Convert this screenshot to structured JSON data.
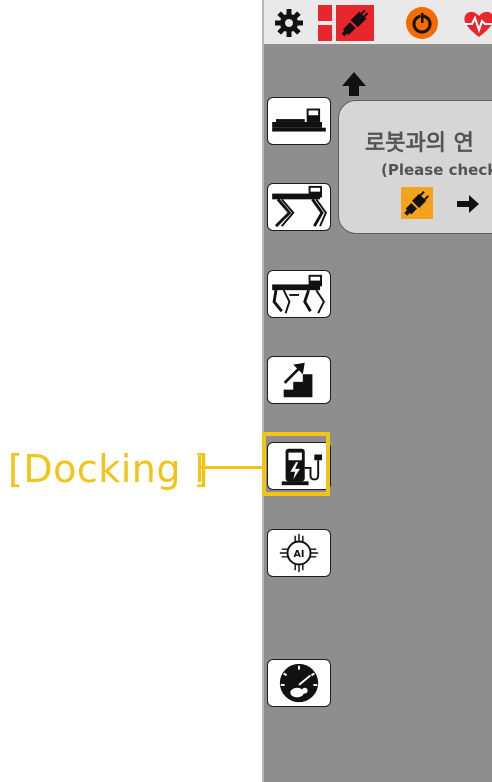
{
  "annotation": {
    "label": "[Docking ]",
    "color": "#f2c417"
  },
  "topbar": {
    "icons": [
      "gear-icon",
      "network-disconnected-icon",
      "power-icon",
      "heart-rate-icon"
    ],
    "status_color": "#e8262b"
  },
  "message": {
    "title": "로봇과의 연",
    "subtitle": "(Please check"
  },
  "sidebar": {
    "items": [
      {
        "name": "lie-down-mode-button",
        "icon": "robot-lying-icon"
      },
      {
        "name": "stand-mode-button",
        "icon": "robot-standing-icon"
      },
      {
        "name": "walk-mode-button",
        "icon": "robot-walking-icon"
      },
      {
        "name": "stairs-mode-button",
        "icon": "stairs-icon"
      },
      {
        "name": "docking-button",
        "icon": "charging-station-icon"
      },
      {
        "name": "ai-mode-button",
        "icon": "ai-brain-icon"
      },
      {
        "name": "speed-mode-button",
        "icon": "speedometer-icon"
      }
    ]
  },
  "colors": {
    "panel": "#8e8e8e",
    "topbar": "#e9e9e9",
    "message_bg": "#d6d6d6",
    "accent_orange": "#f5a21c",
    "power_orange": "#f56b00"
  }
}
